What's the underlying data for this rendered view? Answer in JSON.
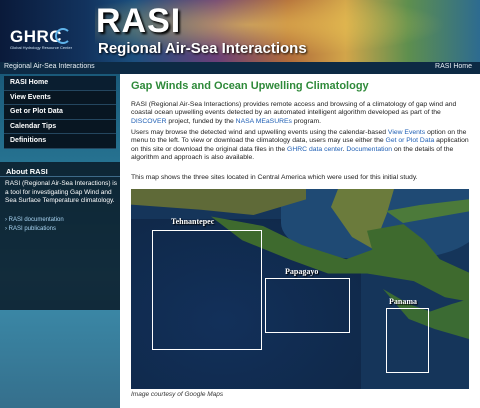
{
  "header": {
    "logo_text": "GHRC",
    "logo_subtext": "Global Hydrology Resource Center",
    "title": "RASI",
    "subtitle": "Regional Air-Sea Interactions"
  },
  "topbar": {
    "left_text": "Regional Air-Sea Interactions",
    "right_link": "RASI Home"
  },
  "sidebar": {
    "nav": [
      {
        "label": "RASI Home",
        "active": true
      },
      {
        "label": "View Events"
      },
      {
        "label": "Get or Plot Data"
      },
      {
        "label": "Calendar Tips"
      },
      {
        "label": "Definitions"
      }
    ],
    "about": {
      "title": "About RASI",
      "text": "RASI (Regional Air-Sea Interactions) is a tool for investigating Gap Wind and Sea Surface Temperature climatology.",
      "links": [
        "› RASI documentation",
        "› RASI publications"
      ]
    }
  },
  "main": {
    "title": "Gap Winds and Ocean Upwelling Climatology",
    "para1": {
      "t1": "RASI (Regional Air-Sea Interactions) provides remote access and browsing of a climatology of gap wind and coastal ocean upwelling events detected by an automated intelligent algorithm developed as part of the ",
      "link1": "DISCOVER",
      "t2": " project, funded by the ",
      "link2": "NASA MEaSUREs",
      "t3": " program."
    },
    "para2": {
      "t1": "Users may browse the detected wind and upwelling events using the calendar-based ",
      "link1": "View Events",
      "t2": " option on the menu to the left. To view or download the climatology data, users may use either the ",
      "link2": "Get or Plot Data",
      "t3": " application on this site or download the original data files in the ",
      "link3": "GHRC data center",
      "t4": ". ",
      "link4": "Documentation",
      "t5": " on the details of the algorithm and approach is also available."
    },
    "para3": "This map shows the three sites located in Central America which were used for this initial study.",
    "map": {
      "regions": [
        {
          "label": "Tehnantepec"
        },
        {
          "label": "Papagayo"
        },
        {
          "label": "Panama"
        }
      ],
      "caption": "Image courtesy of Google Maps"
    }
  },
  "colors": {
    "title_green": "#2f8a3a",
    "link_blue": "#1f5fb4",
    "nav_bg": "#081622"
  }
}
